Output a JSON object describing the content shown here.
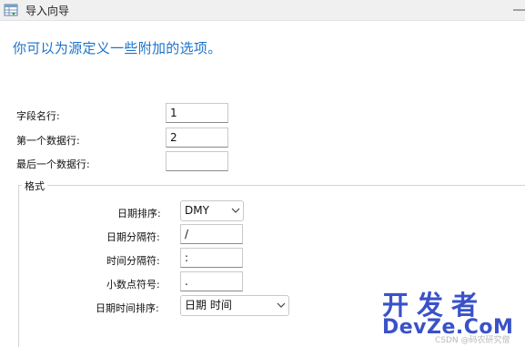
{
  "window": {
    "title": "导入向导"
  },
  "headline": "你可以为源定义一些附加的选项。",
  "rows": {
    "field_name_row": {
      "label": "字段名行:",
      "value": "1"
    },
    "first_data_row": {
      "label": "第一个数据行:",
      "value": "2"
    },
    "last_data_row": {
      "label": "最后一个数据行:",
      "value": ""
    }
  },
  "format_group": {
    "title": "格式",
    "date_order": {
      "label": "日期排序:",
      "value": "DMY"
    },
    "date_delimiter": {
      "label": "日期分隔符:",
      "value": "/"
    },
    "time_delimiter": {
      "label": "时间分隔符:",
      "value": ":"
    },
    "decimal_symbol": {
      "label": "小数点符号:",
      "value": "."
    },
    "datetime_order": {
      "label": "日期时间排序:",
      "value": "日期 时间"
    }
  },
  "watermark": {
    "cn": "开发者",
    "en": "DevZe.CoM",
    "csdn": "CSDN @码农研究僧"
  },
  "colors": {
    "accent": "#1e73c8",
    "watermark": "#3a52c8"
  },
  "icons": {
    "app": "table-import-icon",
    "close": "close-icon",
    "dropdown": "chevron-down-icon"
  }
}
